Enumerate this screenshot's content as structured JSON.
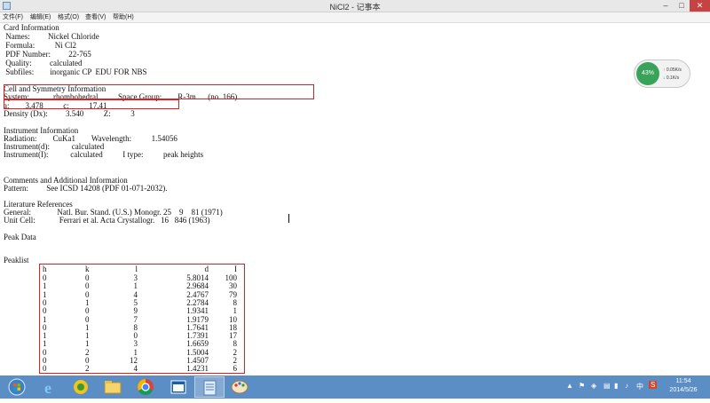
{
  "window": {
    "title": "NiCl2 - 记事本",
    "min_symbol": "–",
    "max_symbol": "□",
    "close_symbol": "✕"
  },
  "menu": [
    {
      "label": "文件(F)"
    },
    {
      "label": "编辑(E)"
    },
    {
      "label": "格式(O)"
    },
    {
      "label": "查看(V)"
    },
    {
      "label": "帮助(H)"
    }
  ],
  "lines": [
    "Card Information",
    " Names:         Nickel Chloride",
    " Formula:          Ni Cl2",
    " PDF Number:         22-765",
    " Quality:         calculated",
    " Subfiles:        inorganic CP  EDU FOR NBS",
    "",
    "Cell and Symmetry Information",
    "System:            rhombohedral          Space Group:        R-3m      (no. 166)",
    "a:        3.478          c:          17.41",
    "Density (Dx):         3.540          Z:          3",
    "",
    "Instrument Information",
    "Radiation:        CuKa1        Wavelength:          1.54056",
    "Instrument(d):           calculated",
    "Instrument(I):           calculated          I type:          peak heights",
    "",
    "",
    "Comments and Additional Information",
    "Pattern:         See ICSD 14208 (PDF 01-071-2032).",
    "",
    "Literature References",
    "General:             Natl. Bur. Stand. (U.S.) Monogr. 25    9    81 (1971)",
    "Unit Cell:            Ferrari et al. Acta Crystallogr.   16   846 (1963)",
    "",
    "Peak Data",
    "",
    "",
    "Peaklist"
  ],
  "peaklist": {
    "headers": [
      "h",
      "k",
      "l",
      "d",
      "I"
    ],
    "rows": [
      [
        "0",
        "0",
        "3",
        "5.8014",
        "100"
      ],
      [
        "1",
        "0",
        "1",
        "2.9684",
        "30"
      ],
      [
        "1",
        "0",
        "4",
        "2.4767",
        "79"
      ],
      [
        "0",
        "1",
        "5",
        "2.2784",
        "8"
      ],
      [
        "0",
        "0",
        "9",
        "1.9341",
        "1"
      ],
      [
        "1",
        "0",
        "7",
        "1.9179",
        "10"
      ],
      [
        "0",
        "1",
        "8",
        "1.7641",
        "18"
      ],
      [
        "1",
        "1",
        "0",
        "1.7391",
        "17"
      ],
      [
        "1",
        "1",
        "3",
        "1.6659",
        "8"
      ],
      [
        "0",
        "2",
        "1",
        "1.5004",
        "2"
      ],
      [
        "0",
        "0",
        "12",
        "1.4507",
        "2"
      ],
      [
        "0",
        "2",
        "4",
        "1.4231",
        "6"
      ]
    ]
  },
  "netmeter": {
    "percent": "43%",
    "upload": "0.05K/s",
    "download": "0.1K/s",
    "up_arrow": "↑",
    "down_arrow": "↓"
  },
  "taskbar": {
    "apps": [
      {
        "icon": "start-orb-icon"
      },
      {
        "icon": "internet-explorer-icon"
      },
      {
        "icon": "security-app-icon"
      },
      {
        "icon": "file-explorer-icon"
      },
      {
        "icon": "chrome-icon"
      },
      {
        "icon": "window-app-icon"
      },
      {
        "icon": "notepad-icon"
      },
      {
        "icon": "paint-icon"
      }
    ],
    "ime": "中",
    "time": "11:54",
    "date": "2014/5/26"
  }
}
